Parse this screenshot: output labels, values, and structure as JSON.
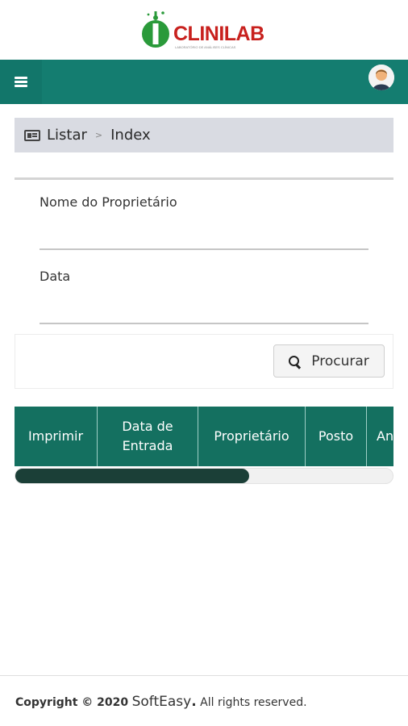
{
  "brand": {
    "logo_text": "CLINILAB",
    "logo_subtitle": "LABORATÓRIO DE ANÁLISES CLÍNICAS",
    "colors": {
      "logo_red": "#c8211e",
      "logo_green": "#2a9a3a",
      "topbar": "#147d70",
      "table_header": "#147060"
    }
  },
  "topbar": {
    "menu_icon": "hamburger-icon",
    "avatar_icon": "user-avatar-icon"
  },
  "breadcrumb": {
    "icon": "list-card-icon",
    "section": "Listar",
    "separator": ">",
    "page": "Index"
  },
  "form": {
    "owner_label": "Nome do Proprietário",
    "owner_value": "",
    "date_label": "Data",
    "date_value": ""
  },
  "actions": {
    "search_label": "Procurar",
    "search_icon": "search-icon"
  },
  "table": {
    "columns": [
      "Imprimir",
      "Data de Entrada",
      "Proprietário",
      "Posto",
      "An"
    ]
  },
  "scroll": {
    "thumb_fraction": 0.62
  },
  "footer": {
    "prefix": "Copyright © 2020",
    "brand_soft": "Soft",
    "brand_easy": "Easy",
    "brand_dot": ".",
    "suffix": " All rights reserved."
  }
}
